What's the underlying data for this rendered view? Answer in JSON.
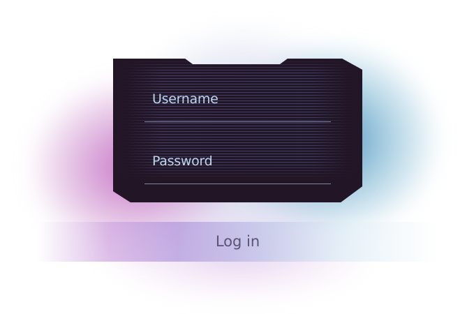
{
  "login_form": {
    "username": {
      "label": "Username",
      "value": ""
    },
    "password": {
      "label": "Password",
      "value": ""
    },
    "submit_label": "Log in"
  },
  "colors": {
    "card_background": "#221526",
    "card_border": "#9fd3e6",
    "label_text": "#bcd6ee",
    "underline": "#7f86a8",
    "glow_pink": "#c46ec4",
    "glow_blue": "#5096be",
    "button_text": "#5a5470"
  }
}
